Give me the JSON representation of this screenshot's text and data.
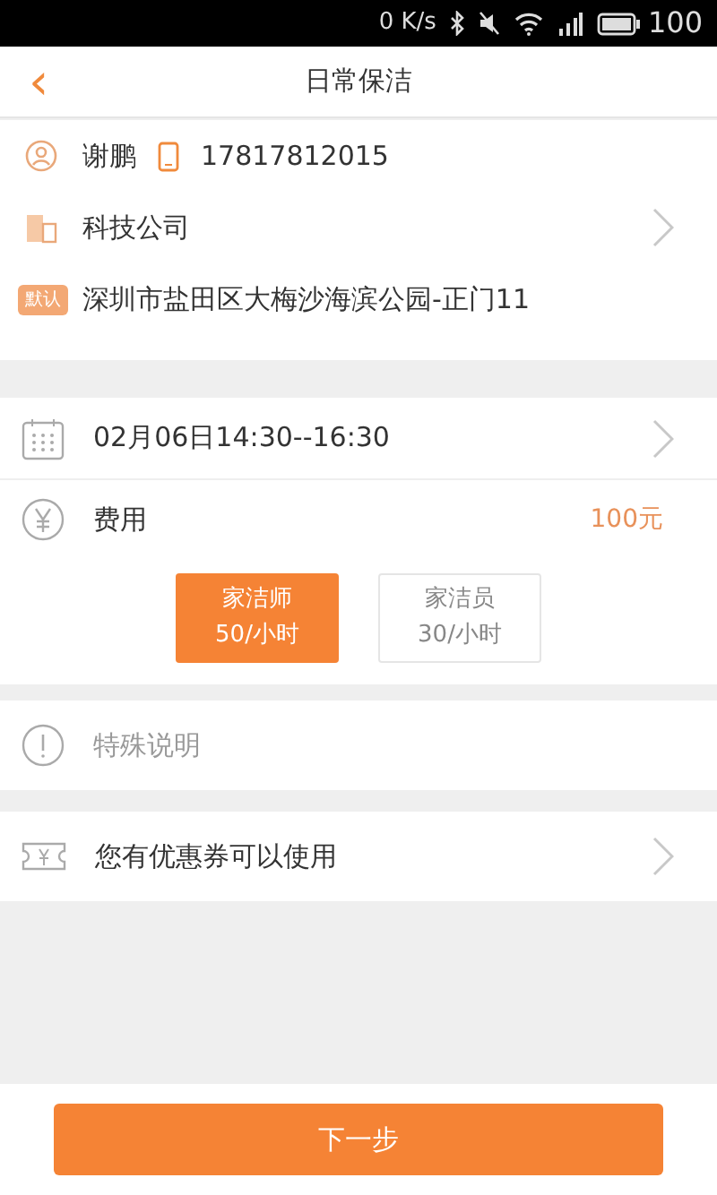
{
  "status_bar": {
    "speed": "0 K/s",
    "battery": "100"
  },
  "header": {
    "back": "‹",
    "title": "日常保洁"
  },
  "contact": {
    "name": "谢鹏",
    "phone": "17817812015",
    "company": "科技公司",
    "default_badge": "默认",
    "address": "深圳市盐田区大梅沙海滨公园-正门11"
  },
  "schedule": {
    "time": "02月06日14:30--16:30",
    "fee_label": "费用",
    "fee_value": "100元",
    "options": [
      {
        "title": "家洁师",
        "price": "50/小时",
        "selected": true
      },
      {
        "title": "家洁员",
        "price": "30/小时",
        "selected": false
      }
    ]
  },
  "special_note": {
    "placeholder": "特殊说明"
  },
  "coupon": {
    "label": "您有优惠券可以使用"
  },
  "next_button": "下一步"
}
